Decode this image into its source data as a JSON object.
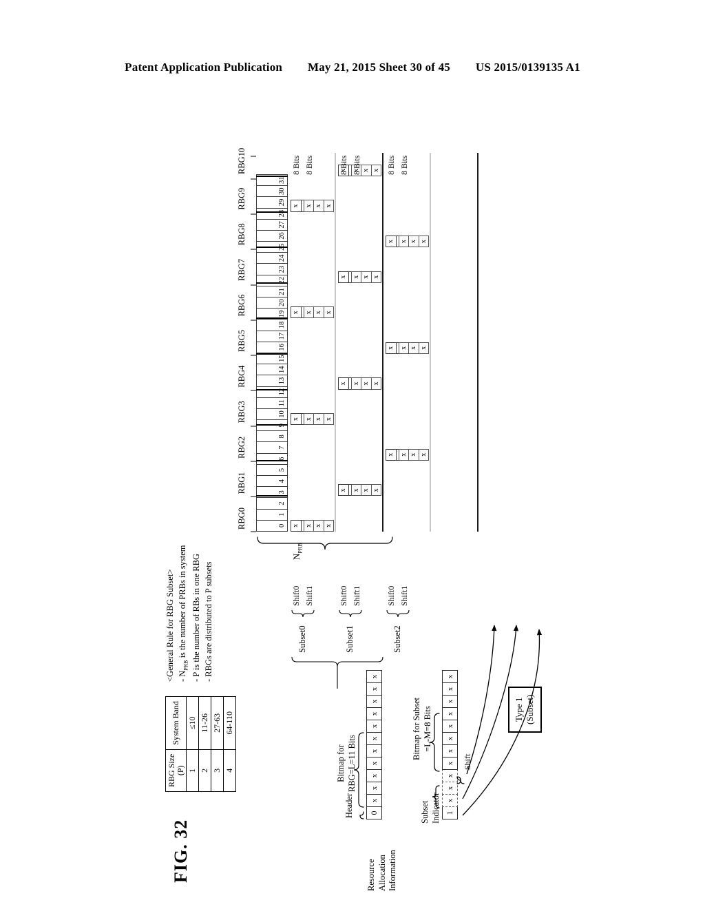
{
  "page_header": {
    "left": "Patent Application Publication",
    "middle": "May 21, 2015  Sheet 30 of 45",
    "right": "US 2015/0139135 A1"
  },
  "figure": {
    "label": "FIG. 32",
    "npre_label": "N",
    "npre_sub": "PRB"
  },
  "table": {
    "headers": [
      "RBG Size\n(P)",
      "System Band"
    ],
    "header_col1_line1": "RBG Size",
    "header_col1_line2": "(P)",
    "header_col2": "System Band",
    "rows": [
      {
        "p": "1",
        "band": "≤10"
      },
      {
        "p": "2",
        "band": "11-26"
      },
      {
        "p": "3",
        "band": "27-63"
      },
      {
        "p": "4",
        "band": "64-110"
      }
    ]
  },
  "general_rule": {
    "title": "<General Rule for RBG Subset>",
    "lines": [
      "- N_PRB is the number of PRBs in system",
      "- P is the number of RBs in one RBG",
      "- RBGs are distributed to P subsets"
    ],
    "line1_pre": "- N",
    "line1_sub": "PRB",
    "line1_post": " is the number of PRBs in system",
    "line2": "- P is the number of RBs in one RBG",
    "line3": "- RBGs are distributed to P subsets"
  },
  "resource_allocation": {
    "title_line1": "Resource",
    "title_line2": "Allocation",
    "title_line3": "Information",
    "row1": {
      "header_label": "Header",
      "bitmap_label_line1": "Bitmap for",
      "bitmap_label_line2": "RBG=L=11 Bits",
      "header_bit": "0",
      "bits": [
        "x",
        "x",
        "x",
        "x",
        "x",
        "x",
        "x",
        "x",
        "x",
        "x",
        "x"
      ]
    },
    "row2": {
      "header_bit": "1",
      "subset_indicator_label_line1": "Subset",
      "subset_indicator_label_line2": "Indicator",
      "subset_indicator_bits": [
        "x",
        "x"
      ],
      "shift_label": "Shift",
      "shift_bits": [
        "x"
      ],
      "bitmap_label_line1": "Bitmap for Subset",
      "bitmap_label_line2": "=L-M=8 Bits",
      "bits": [
        "x",
        "x",
        "x",
        "x",
        "x",
        "x",
        "x",
        "x"
      ]
    }
  },
  "prb_grid": {
    "rbg_labels": [
      "RBG0",
      "RBG1",
      "RBG2",
      "RBG3",
      "RBG4",
      "RBG5",
      "RBG6",
      "RBG7",
      "RBG8",
      "RBG9",
      "RBG10"
    ],
    "prb_indices": [
      "0",
      "1",
      "2",
      "3",
      "4",
      "5",
      "6",
      "7",
      "8",
      "9",
      "10",
      "11",
      "12",
      "13",
      "14",
      "15",
      "16",
      "17",
      "18",
      "19",
      "20",
      "21",
      "22",
      "23",
      "24",
      "25",
      "26",
      "27",
      "28",
      "29",
      "30",
      "31"
    ],
    "rbg_size": 3,
    "total_rbgs": 11
  },
  "subsets": {
    "bits_label": "8 Bits",
    "bits_labels": [
      "8 Bits",
      "8 Bits",
      "8 Bits",
      "8 Bits",
      "8 Bits",
      "8 Bits"
    ],
    "groups": [
      {
        "name": "Subset0",
        "shifts": [
          "Shift0",
          "Shift1"
        ]
      },
      {
        "name": "Subset1",
        "shifts": [
          "Shift0",
          "Shift1"
        ]
      },
      {
        "name": "Subset2",
        "shifts": [
          "Shift0",
          "Shift1"
        ]
      }
    ],
    "cell_mark": "x",
    "columns": [
      {
        "group": 0,
        "shift": 0,
        "rbgs": [
          0,
          3,
          6,
          9
        ]
      },
      {
        "group": 0,
        "shift": 1,
        "rbgs": [
          0,
          3,
          6,
          9
        ]
      },
      {
        "group": 1,
        "shift": 0,
        "rbgs": [
          1,
          4,
          7,
          10
        ]
      },
      {
        "group": 1,
        "shift": 1,
        "rbgs": [
          1,
          4,
          7,
          10
        ]
      },
      {
        "group": 2,
        "shift": 0,
        "rbgs": [
          2,
          5,
          8
        ]
      },
      {
        "group": 2,
        "shift": 1,
        "rbgs": [
          2,
          5,
          8
        ]
      }
    ]
  },
  "type1_box": {
    "line1": "Type 1",
    "line2": "(Subset)"
  }
}
